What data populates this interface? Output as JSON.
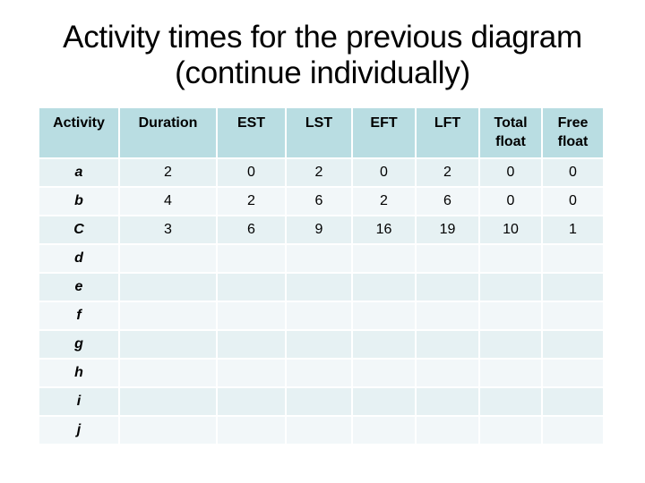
{
  "slide": {
    "title_line1": "Activity times for the previous diagram",
    "title_line2": "(continue individually)"
  },
  "table": {
    "headers": [
      [
        "Activity"
      ],
      [
        "Duration"
      ],
      [
        "EST"
      ],
      [
        "LST"
      ],
      [
        "EFT"
      ],
      [
        "LFT"
      ],
      [
        "Total",
        "float"
      ],
      [
        "Free",
        "float"
      ]
    ],
    "rows": [
      [
        "a",
        "2",
        "0",
        "2",
        "0",
        "2",
        "0",
        "0"
      ],
      [
        "b",
        "4",
        "2",
        "6",
        "2",
        "6",
        "0",
        "0"
      ],
      [
        "C",
        "3",
        "6",
        "9",
        "16",
        "19",
        "10",
        "1"
      ],
      [
        "d",
        "",
        "",
        "",
        "",
        "",
        "",
        ""
      ],
      [
        "e",
        "",
        "",
        "",
        "",
        "",
        "",
        ""
      ],
      [
        "f",
        "",
        "",
        "",
        "",
        "",
        "",
        ""
      ],
      [
        "g",
        "",
        "",
        "",
        "",
        "",
        "",
        ""
      ],
      [
        "h",
        "",
        "",
        "",
        "",
        "",
        "",
        ""
      ],
      [
        "i",
        "",
        "",
        "",
        "",
        "",
        "",
        ""
      ],
      [
        "j",
        "",
        "",
        "",
        "",
        "",
        "",
        ""
      ]
    ]
  },
  "colors": {
    "header_bg": "#b9dde2",
    "row_odd_bg": "#e6f1f3",
    "row_even_bg": "#f2f7f9"
  }
}
